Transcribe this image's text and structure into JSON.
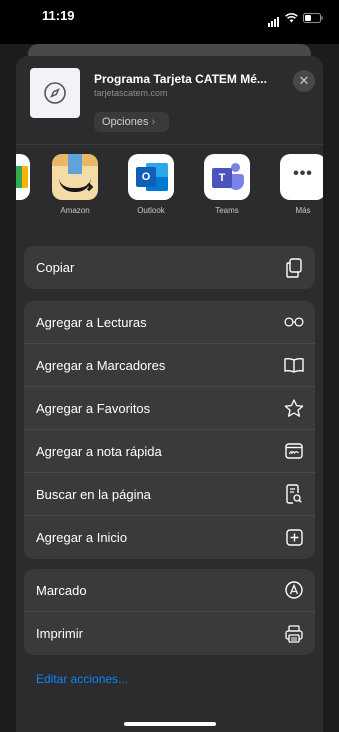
{
  "status_bar": {
    "time": "11:19"
  },
  "header": {
    "title": "Programa Tarjeta CATEM Mé...",
    "url": "tarjetascatem.com",
    "options_label": "Opciones",
    "close_symbol": "✕",
    "thumbnail_icon": "compass-icon"
  },
  "apps": [
    {
      "label": "Amazon",
      "icon": "amazon-icon"
    },
    {
      "label": "Outlook",
      "icon": "outlook-icon"
    },
    {
      "label": "Teams",
      "icon": "teams-icon"
    },
    {
      "label": "Más",
      "icon": "more-icon"
    }
  ],
  "outlook_letter": "O",
  "teams_letter": "T",
  "more_dots": "•••",
  "groups": [
    {
      "items": [
        {
          "label": "Copiar",
          "icon": "copy-icon"
        }
      ]
    },
    {
      "items": [
        {
          "label": "Agregar a Lecturas",
          "icon": "glasses-icon"
        },
        {
          "label": "Agregar a Marcadores",
          "icon": "book-icon"
        },
        {
          "label": "Agregar a Favoritos",
          "icon": "star-icon"
        },
        {
          "label": "Agregar a nota rápida",
          "icon": "quick-note-icon"
        },
        {
          "label": "Buscar en la página",
          "icon": "find-in-page-icon"
        },
        {
          "label": "Agregar a Inicio",
          "icon": "add-square-icon"
        }
      ]
    },
    {
      "items": [
        {
          "label": "Marcado",
          "icon": "markup-icon"
        },
        {
          "label": "Imprimir",
          "icon": "printer-icon"
        }
      ]
    }
  ],
  "edit_actions_label": "Editar acciones...",
  "colors": {
    "link": "#0a84ff",
    "sheet": "#2c2c2e",
    "row": "#3a3a3c"
  }
}
